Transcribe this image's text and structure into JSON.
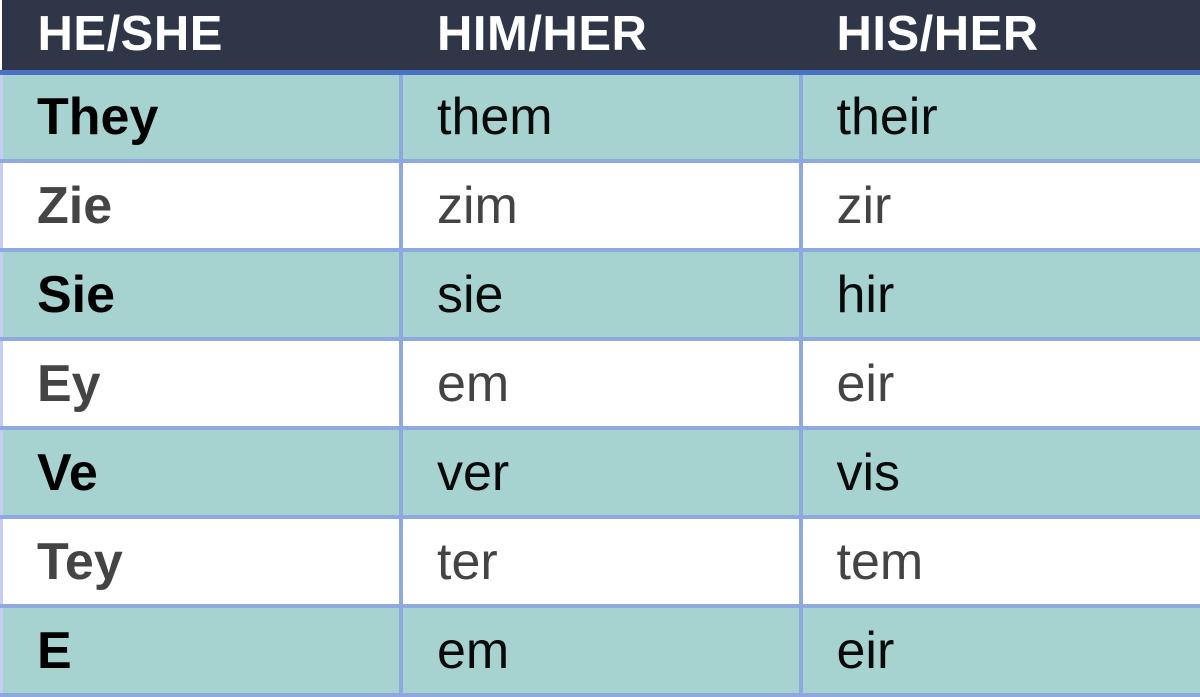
{
  "table": {
    "columns": [
      {
        "key": "subject",
        "label": "HE/SHE"
      },
      {
        "key": "object",
        "label": "HIM/HER"
      },
      {
        "key": "possessive",
        "label": "HIS/HER"
      }
    ],
    "rows": [
      {
        "subject": "They",
        "object": "them",
        "possessive": "their",
        "shaded": true
      },
      {
        "subject": "Zie",
        "object": "zim",
        "possessive": "zir",
        "shaded": false
      },
      {
        "subject": "Sie",
        "object": "sie",
        "possessive": "hir",
        "shaded": true
      },
      {
        "subject": "Ey",
        "object": "em",
        "possessive": "eir",
        "shaded": false
      },
      {
        "subject": "Ve",
        "object": "ver",
        "possessive": "vis",
        "shaded": true
      },
      {
        "subject": "Tey",
        "object": "ter",
        "possessive": "tem",
        "shaded": false
      },
      {
        "subject": "E",
        "object": "em",
        "possessive": "eir",
        "shaded": true
      }
    ]
  },
  "colors": {
    "header_background": "#2e3648",
    "header_text": "#ffffff",
    "header_rule": "#4a72c4",
    "row_shaded_background": "#a6d2d0",
    "row_plain_background": "#ffffff",
    "grid_line": "#8fa8e0",
    "edge_line": "#c3cef0",
    "text_shaded": "#000000",
    "text_plain": "#444444"
  }
}
